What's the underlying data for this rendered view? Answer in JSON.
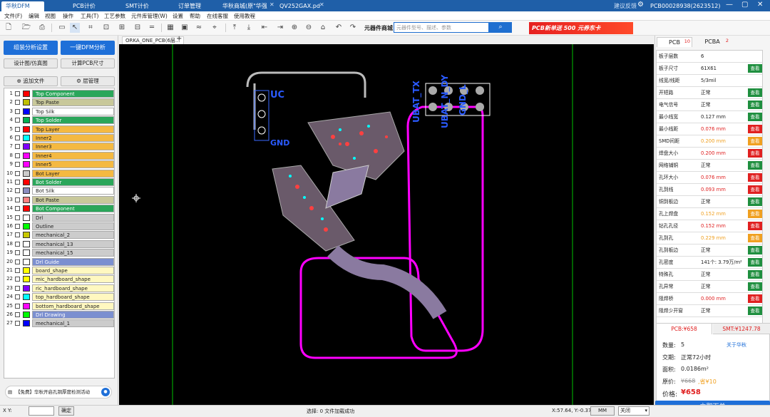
{
  "titlebar": {
    "tabs": [
      "华秋DFM",
      "PCB计价",
      "SMT计价",
      "订单管理",
      "华秋商城(原\"华强"
    ],
    "doc_tab": "QV252GAX.pd",
    "feedback": "建议反馈",
    "user": "PCB00028938(2623512)",
    "min": "—",
    "max": "▢",
    "close": "✕"
  },
  "menubar": [
    "文件(F)",
    "编辑",
    "视图",
    "操作",
    "工具(T)",
    "工艺参数",
    "元件库管理(W)",
    "设置",
    "帮助",
    "在线客服",
    "使用教程"
  ],
  "toolbar": {
    "component_mall": "元器件商城",
    "search_placeholder": "元器件型号、描述、参数",
    "banner": "PCB新单送 500 元券东卡"
  },
  "left": {
    "assembly_btn": "组装分析设置",
    "dfm_btn": "一键DFM分析",
    "design_sim_btn": "设计图/仿真图",
    "calc_size_btn": "计算PCB尺寸",
    "add_file_btn": "追加文件",
    "layer_mgmt_btn": "层管理",
    "notice": "【免费】华秋开启孔铜厚度检测活动"
  },
  "layers": [
    {
      "num": "1",
      "name": "Top Component",
      "color": "#ff0000",
      "bg": "#2aa65a",
      "fg": "#ffffff"
    },
    {
      "num": "2",
      "name": "Top Paste",
      "color": "#bfbf00",
      "bg": "#c8c89a",
      "fg": "#222222"
    },
    {
      "num": "3",
      "name": "Top Silk",
      "color": "#0000ff",
      "bg": "#ffffff",
      "fg": "#222222"
    },
    {
      "num": "4",
      "name": "Top Solder",
      "color": "#00b050",
      "bg": "#2aa65a",
      "fg": "#ffffff"
    },
    {
      "num": "5",
      "name": "Top Layer",
      "color": "#ff0000",
      "bg": "#f4b942",
      "fg": "#222222"
    },
    {
      "num": "6",
      "name": "Inner2",
      "color": "#00ffff",
      "bg": "#f4b942",
      "fg": "#222222"
    },
    {
      "num": "7",
      "name": "Inner3",
      "color": "#8000ff",
      "bg": "#f4b942",
      "fg": "#222222"
    },
    {
      "num": "8",
      "name": "Inner4",
      "color": "#ff00ff",
      "bg": "#f4b942",
      "fg": "#222222"
    },
    {
      "num": "9",
      "name": "Inner5",
      "color": "#ff00ff",
      "bg": "#f4b942",
      "fg": "#222222"
    },
    {
      "num": "10",
      "name": "Bot Layer",
      "color": "#cccccc",
      "bg": "#f4b942",
      "fg": "#222222"
    },
    {
      "num": "11",
      "name": "Bot Solder",
      "color": "#ff0000",
      "bg": "#2aa65a",
      "fg": "#ffffff"
    },
    {
      "num": "12",
      "name": "Bot Silk",
      "color": "#8c8cc0",
      "bg": "#ffffff",
      "fg": "#222222"
    },
    {
      "num": "13",
      "name": "Bot Paste",
      "color": "#ff8080",
      "bg": "#c8c89a",
      "fg": "#222222"
    },
    {
      "num": "14",
      "name": "Bot Component",
      "color": "#ff0000",
      "bg": "#2aa65a",
      "fg": "#ffffff"
    },
    {
      "num": "15",
      "name": "Drl",
      "color": "#ffffff",
      "bg": "#cccccc",
      "fg": "#222222"
    },
    {
      "num": "16",
      "name": "Outline",
      "color": "#00ff00",
      "bg": "#cccccc",
      "fg": "#222222"
    },
    {
      "num": "17",
      "name": "mechanical_2",
      "color": "#c8c800",
      "bg": "#cccccc",
      "fg": "#222222"
    },
    {
      "num": "18",
      "name": "mechanical_13",
      "color": "#ffffff",
      "bg": "#cccccc",
      "fg": "#222222"
    },
    {
      "num": "19",
      "name": "mechanical_15",
      "color": "#ffffff",
      "bg": "#cccccc",
      "fg": "#222222"
    },
    {
      "num": "20",
      "name": "Drl Guide",
      "color": "#ffffff",
      "bg": "#7b8fd0",
      "fg": "#ffffff"
    },
    {
      "num": "21",
      "name": "board_shape",
      "color": "#ffff00",
      "bg": "#fff8c0",
      "fg": "#222222"
    },
    {
      "num": "22",
      "name": "mic_hardboard_shape",
      "color": "#ffff00",
      "bg": "#fff8c0",
      "fg": "#222222"
    },
    {
      "num": "23",
      "name": "ric_hardboard_shape",
      "color": "#8000ff",
      "bg": "#fff8c0",
      "fg": "#222222"
    },
    {
      "num": "24",
      "name": "top_hardboard_shape",
      "color": "#00ffff",
      "bg": "#fff8c0",
      "fg": "#222222"
    },
    {
      "num": "25",
      "name": "bottom_hardboard_shape",
      "color": "#ff00ff",
      "bg": "#fff8c0",
      "fg": "#222222"
    },
    {
      "num": "26",
      "name": "Drl Drawing",
      "color": "#00ff00",
      "bg": "#7b8fd0",
      "fg": "#ffffff"
    },
    {
      "num": "27",
      "name": "mechanical_1",
      "color": "#0000ff",
      "bg": "#cccccc",
      "fg": "#222222"
    }
  ],
  "canvas": {
    "doc_tab": "ORKA_ONE_PCB(6层...",
    "silk": [
      "UC",
      "GND",
      "UBAT_TX",
      "UBAT_N_DY",
      "GND_L"
    ]
  },
  "right": {
    "tab_pcb": "PCB",
    "tab_pcb_count": "10",
    "tab_pcba": "PCBA",
    "tab_pcba_count": "2",
    "props": [
      {
        "label": "板子层数",
        "value": "6",
        "state": "none",
        "btn": ""
      },
      {
        "label": "板子尺寸",
        "value": "61X61",
        "state": "normal",
        "btn": "查看"
      },
      {
        "label": "线宽/线距",
        "value": "5/3mil",
        "state": "none",
        "btn": ""
      },
      {
        "label": "开短路",
        "value": "正常",
        "state": "green",
        "btn": "查看"
      },
      {
        "label": "电气信号",
        "value": "正常",
        "state": "green",
        "btn": "查看"
      },
      {
        "label": "最小线宽",
        "value": "0.127 mm",
        "state": "green",
        "btn": "查看"
      },
      {
        "label": "最小线距",
        "value": "0.076 mm",
        "state": "red",
        "btn": "查看"
      },
      {
        "label": "SMD间距",
        "value": "0.200 mm",
        "state": "orange",
        "btn": "查看"
      },
      {
        "label": "焊盘大小",
        "value": "0.200 mm",
        "state": "red",
        "btn": "查看"
      },
      {
        "label": "网络铺铜",
        "value": "正常",
        "state": "green",
        "btn": "查看"
      },
      {
        "label": "孔环大小",
        "value": "0.076 mm",
        "state": "red",
        "btn": "查看"
      },
      {
        "label": "孔到线",
        "value": "0.093 mm",
        "state": "red",
        "btn": "查看"
      },
      {
        "label": "铜到板边",
        "value": "正常",
        "state": "green",
        "btn": "查看"
      },
      {
        "label": "孔上焊盘",
        "value": "0.152 mm",
        "state": "orange",
        "btn": "查看"
      },
      {
        "label": "钻孔孔径",
        "value": "0.152 mm",
        "state": "red",
        "btn": "查看"
      },
      {
        "label": "孔到孔",
        "value": "0.229 mm",
        "state": "orange",
        "btn": "查看"
      },
      {
        "label": "孔到板边",
        "value": "正常",
        "state": "green",
        "btn": "查看"
      },
      {
        "label": "孔密度",
        "value": "141个: 3.79万/m²",
        "state": "green",
        "btn": "查看"
      },
      {
        "label": "特殊孔",
        "value": "正常",
        "state": "green",
        "btn": "查看"
      },
      {
        "label": "孔异常",
        "value": "正常",
        "state": "green",
        "btn": "查看"
      },
      {
        "label": "阻焊桥",
        "value": "0.000 mm",
        "state": "red",
        "btn": "查看"
      },
      {
        "label": "阻焊少开窗",
        "value": "正常",
        "state": "green",
        "btn": "查看"
      }
    ],
    "price_tab_pcb": "PCB:¥658",
    "price_tab_smt": "SMT:¥1247.78",
    "qty_label": "数量:",
    "qty": "5",
    "about": "关于华秋",
    "delivery_label": "交期:",
    "delivery": "正常72小时",
    "area_label": "面积:",
    "area": "0.0186m²",
    "orig_label": "原价:",
    "orig": "¥668",
    "save": ",省¥10",
    "price_label": "价格:",
    "price": "¥658",
    "order_btn": "立即下单"
  },
  "status": {
    "xy_label": "X Y:",
    "confirm": "确定",
    "msg": "选择: 0  文件加载成功",
    "coords": "X:57.64, Y:-0.37",
    "unit": "MM",
    "close_opt": "关闭"
  },
  "colors": {
    "brand": "#1e6fd8",
    "ok": "#1f8f3f",
    "err": "#e02020",
    "warn": "#f0a020"
  }
}
